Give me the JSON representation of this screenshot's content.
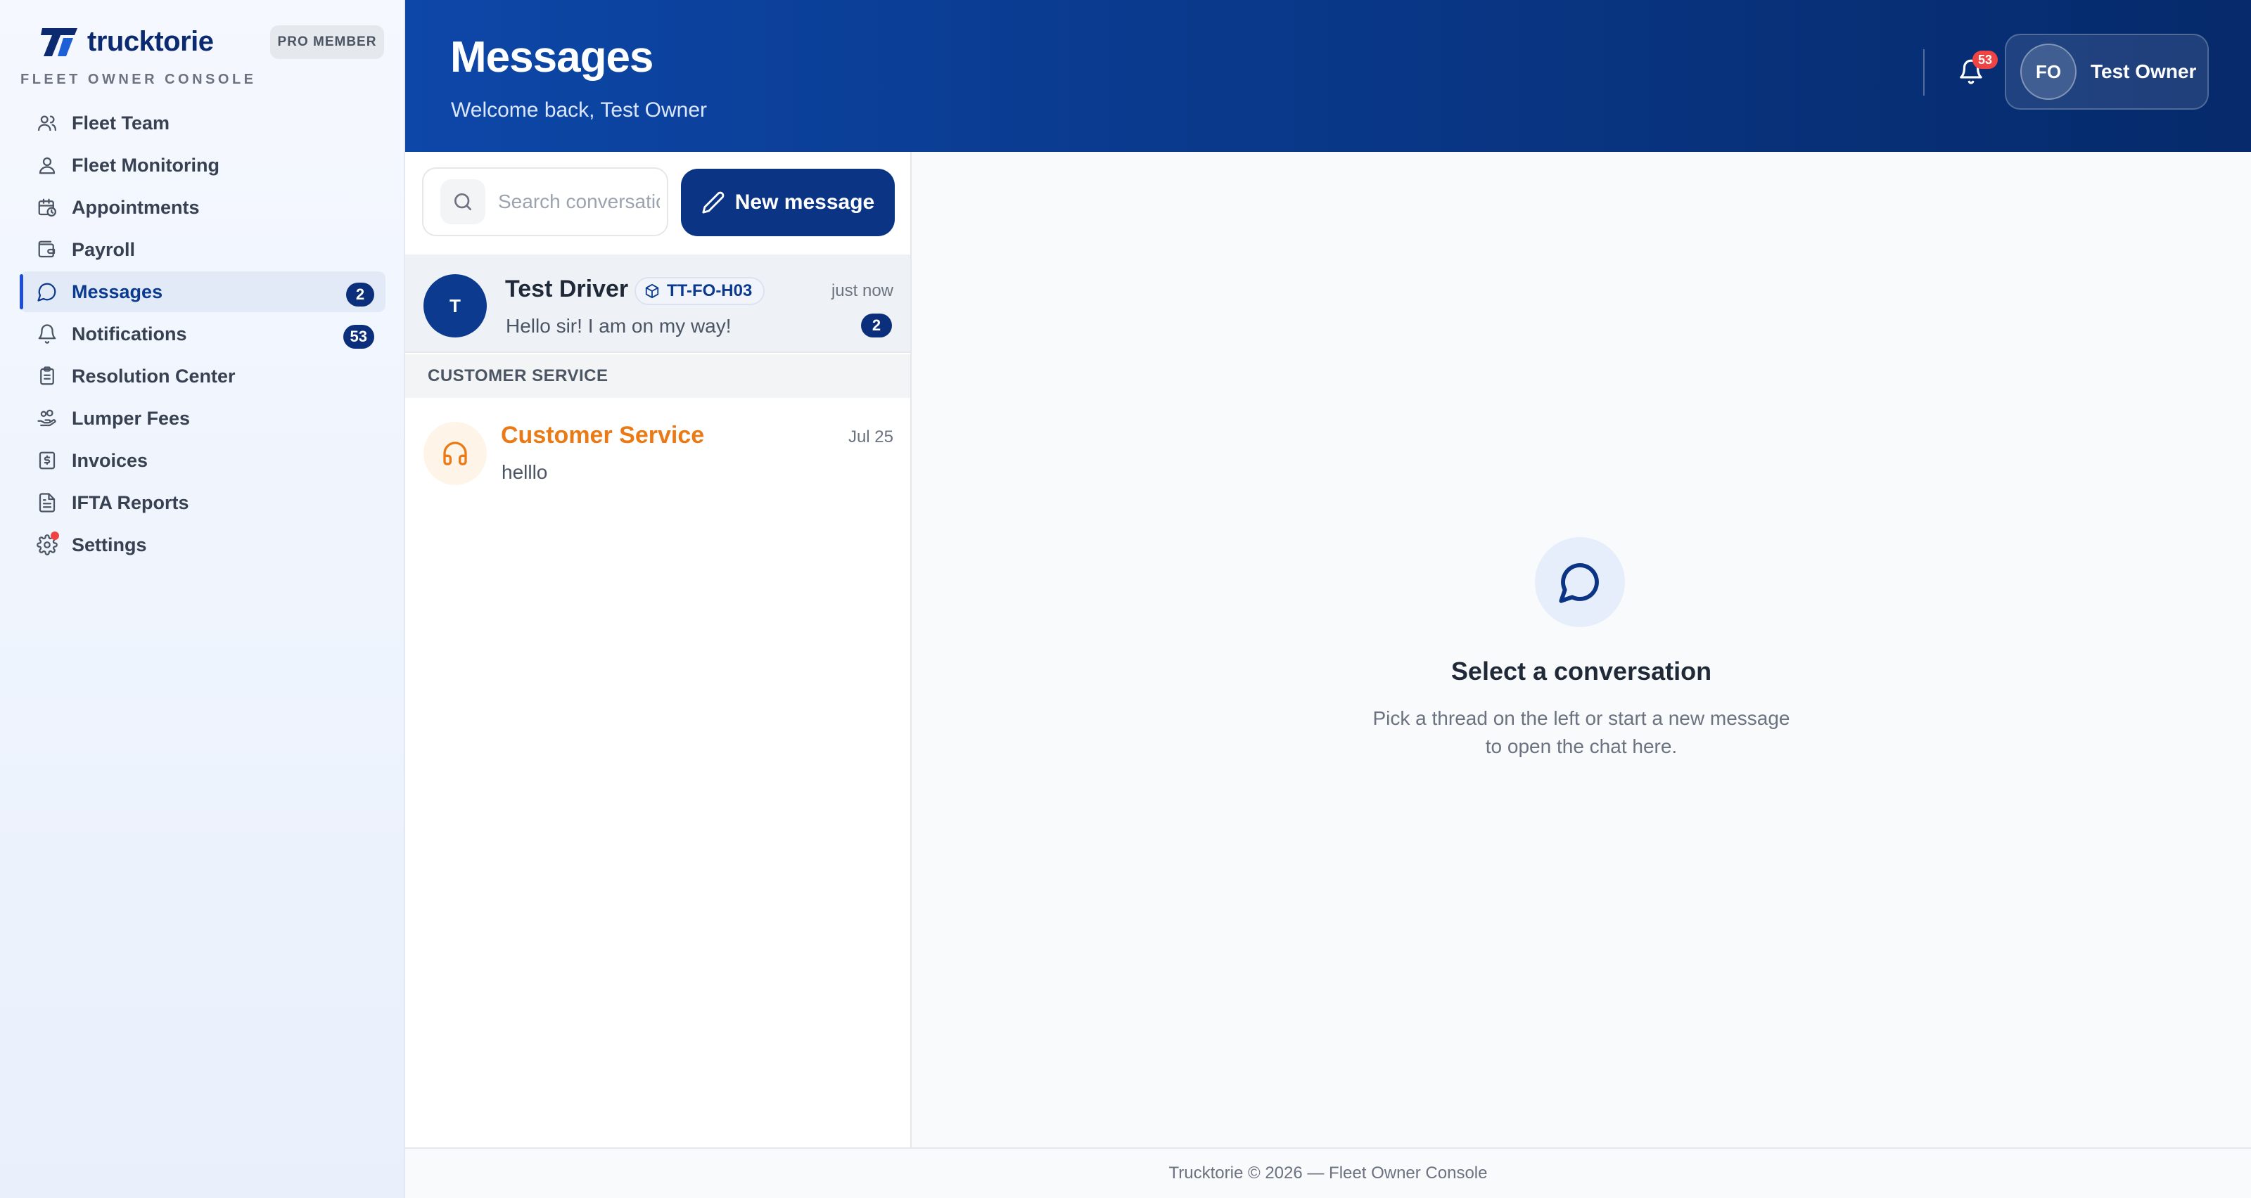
{
  "brand": {
    "name": "trucktorie",
    "badge": "PRO MEMBER",
    "console_label": "FLEET OWNER CONSOLE"
  },
  "sidebar": {
    "items": [
      {
        "label": "Fleet Team",
        "icon": "users-icon"
      },
      {
        "label": "Fleet Monitoring",
        "icon": "user-pin-icon"
      },
      {
        "label": "Appointments",
        "icon": "calendar-clock-icon"
      },
      {
        "label": "Payroll",
        "icon": "wallet-icon"
      },
      {
        "label": "Messages",
        "icon": "message-icon",
        "badge": "2",
        "active": true
      },
      {
        "label": "Notifications",
        "icon": "bell-icon",
        "badge": "53"
      },
      {
        "label": "Resolution Center",
        "icon": "clipboard-icon"
      },
      {
        "label": "Lumper Fees",
        "icon": "hand-coins-icon"
      },
      {
        "label": "Invoices",
        "icon": "receipt-icon"
      },
      {
        "label": "IFTA Reports",
        "icon": "file-text-icon"
      },
      {
        "label": "Settings",
        "icon": "gear-icon"
      }
    ]
  },
  "header": {
    "title": "Messages",
    "welcome": "Welcome back, Test Owner",
    "notification_count": "53",
    "user": {
      "initials": "FO",
      "name": "Test Owner"
    }
  },
  "threads": {
    "search_placeholder": "Search conversations",
    "new_message_label": "New message",
    "driver": {
      "initial": "T",
      "name": "Test Driver",
      "truck_tag": "TT-FO-H03",
      "time": "just now",
      "preview": "Hello sir! I am on my way!",
      "unread": "2"
    },
    "section_label": "CUSTOMER SERVICE",
    "customer_service": {
      "name": "Customer Service",
      "time": "Jul 25",
      "preview": "helllo"
    }
  },
  "conversation": {
    "empty_title": "Select a conversation",
    "empty_subtitle": "Pick a thread on the left or start a new message to open the chat here."
  },
  "footer": {
    "text": "Trucktorie © 2026 — Fleet Owner Console"
  },
  "colors": {
    "primary": "#0b3485",
    "accent_orange": "#ea7a16",
    "badge_red": "#ef4444"
  }
}
